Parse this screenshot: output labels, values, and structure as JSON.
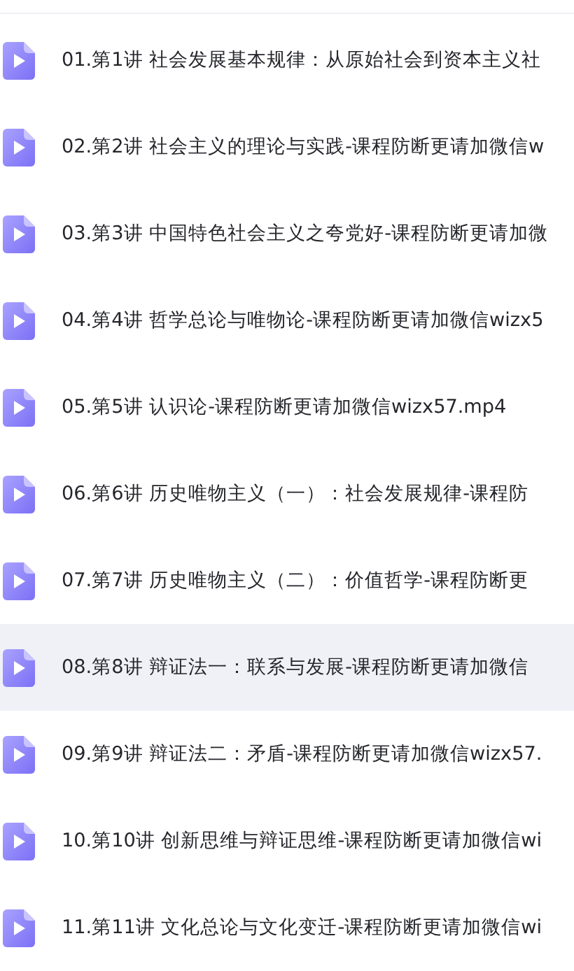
{
  "files": [
    {
      "name": "01.第1讲 社会发展基本规律：从原始社会到资本主义社",
      "selected": false
    },
    {
      "name": "02.第2讲 社会主义的理论与实践-课程防断更请加微信w",
      "selected": false
    },
    {
      "name": "03.第3讲 中国特色社会主义之夸党好-课程防断更请加微",
      "selected": false
    },
    {
      "name": "04.第4讲 哲学总论与唯物论-课程防断更请加微信wizx5",
      "selected": false
    },
    {
      "name": "05.第5讲 认识论-课程防断更请加微信wizx57.mp4",
      "selected": false
    },
    {
      "name": "06.第6讲 历史唯物主义（一）：社会发展规律-课程防",
      "selected": false
    },
    {
      "name": "07.第7讲 历史唯物主义（二）：价值哲学-课程防断更",
      "selected": false
    },
    {
      "name": "08.第8讲 辩证法一：联系与发展-课程防断更请加微信",
      "selected": true
    },
    {
      "name": "09.第9讲 辩证法二：矛盾-课程防断更请加微信wizx57.",
      "selected": false
    },
    {
      "name": "10.第10讲 创新思维与辩证思维-课程防断更请加微信wi",
      "selected": false
    },
    {
      "name": "11.第11讲 文化总论与文化变迁-课程防断更请加微信wi",
      "selected": false
    }
  ]
}
